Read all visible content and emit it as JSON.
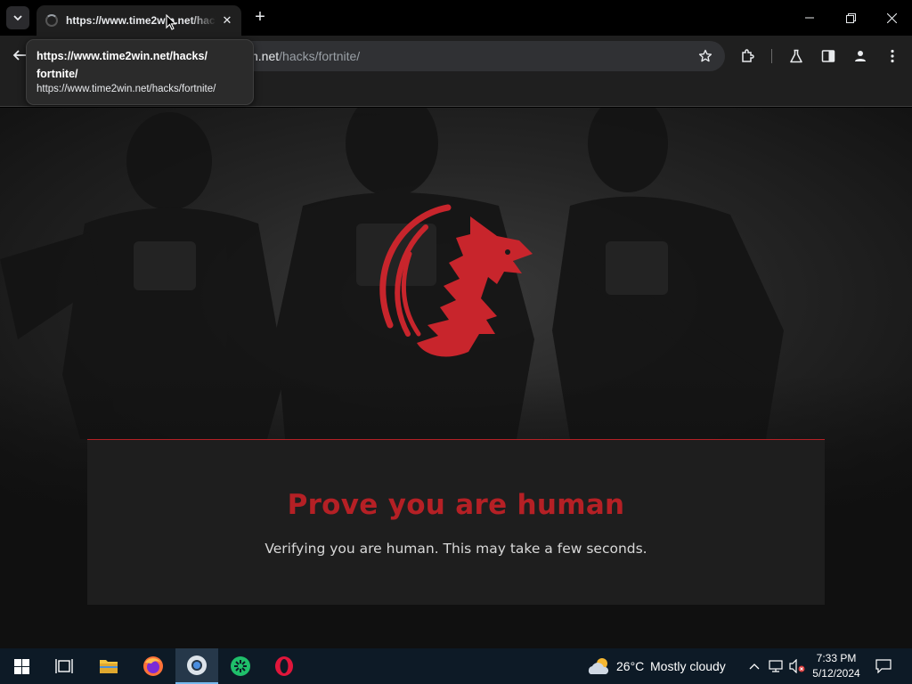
{
  "browser": {
    "tab": {
      "title": "https://www.time2win.net/hacks/fortnite/"
    },
    "address_bar": {
      "url_host": "n.net",
      "url_path": "/hacks/fortnite/"
    },
    "tooltip": {
      "title_line1": "https://www.time2win.net/hacks/",
      "title_line2": "fortnite/",
      "url": "https://www.time2win.net/hacks/fortnite/"
    }
  },
  "page": {
    "heading": "Prove you are human",
    "message": "Verifying you are human. This may take a few seconds.",
    "colors": {
      "accent": "#b52025",
      "panel": "#1e1e1e"
    }
  },
  "taskbar": {
    "pinned_apps": [
      "start-icon",
      "task-view-icon",
      "file-explorer-icon",
      "firefox-icon",
      "chrome-icon",
      "green-app-icon",
      "opera-icon"
    ],
    "weather": {
      "temperature": "26°C",
      "condition": "Mostly cloudy"
    },
    "clock": {
      "time": "7:33 PM",
      "date": "5/12/2024"
    }
  }
}
